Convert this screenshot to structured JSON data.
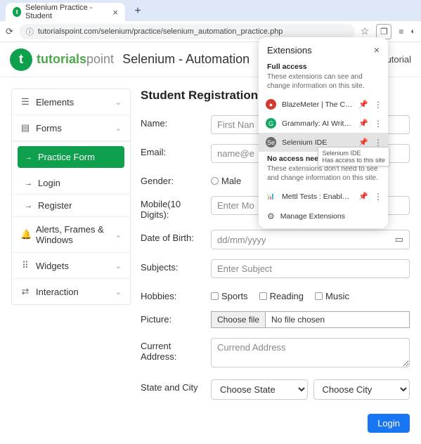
{
  "browser": {
    "tab_title": "Selenium Practice - Student",
    "url": "tutorialspoint.com/selenium/practice/selenium_automation_practice.php",
    "star_icon": "star-icon",
    "ext_icon": "puzzle-icon"
  },
  "header": {
    "logo_green": "tutorials",
    "logo_grey": "point",
    "page_title": "Selenium - Automation",
    "nav_tutorial": "utorial"
  },
  "sidebar": {
    "items": [
      {
        "icon": "☰",
        "label": "Elements",
        "name": "sidebar-item-elements"
      },
      {
        "icon": "▤",
        "label": "Forms",
        "name": "sidebar-item-forms",
        "expanded": true,
        "children": [
          {
            "label": "Practice Form",
            "active": true
          },
          {
            "label": "Login"
          },
          {
            "label": "Register"
          }
        ]
      },
      {
        "icon": "🔔",
        "label": "Alerts, Frames & Windows",
        "name": "sidebar-item-alerts"
      },
      {
        "icon": "⠿",
        "label": "Widgets",
        "name": "sidebar-item-widgets"
      },
      {
        "icon": "⇄",
        "label": "Interaction",
        "name": "sidebar-item-interaction"
      }
    ]
  },
  "form": {
    "heading": "Student Registration Fo",
    "name": {
      "label": "Name:",
      "placeholder": "First Nan"
    },
    "email": {
      "label": "Email:",
      "placeholder": "name@e"
    },
    "gender": {
      "label": "Gender:",
      "options": [
        "Male"
      ]
    },
    "mobile": {
      "label": "Mobile(10 Digits):",
      "placeholder": "Enter Mo"
    },
    "dob": {
      "label": "Date of Birth:",
      "placeholder": "dd/mm/yyyy"
    },
    "subjects": {
      "label": "Subjects:",
      "placeholder": "Enter Subject"
    },
    "hobbies": {
      "label": "Hobbies:",
      "options": [
        "Sports",
        "Reading",
        "Music"
      ]
    },
    "picture": {
      "label": "Picture:",
      "button": "Choose file",
      "status": "No file chosen"
    },
    "address": {
      "label": "Current Address:",
      "placeholder": "Currend Address"
    },
    "state_city": {
      "label": "State and City",
      "state_placeholder": "Choose State",
      "city_placeholder": "Choose City"
    },
    "login_button": "Login"
  },
  "extensions": {
    "title": "Extensions",
    "full_access": {
      "title": "Full access",
      "desc": "These extensions can see and change information on this site."
    },
    "no_access": {
      "title": "No access needed",
      "desc": "These extensions don't need to see and change information on this site."
    },
    "items_full": [
      {
        "name": "BlazeMeter | The Continu...",
        "color": "#d43a2e"
      },
      {
        "name": "Grammarly: AI Writing an...",
        "color": "#16a765"
      },
      {
        "name": "Selenium IDE",
        "color": "#6a6a6a",
        "highlight": true
      }
    ],
    "items_none": [
      {
        "name": "Mettl Tests : Enable Scre...",
        "color": "#5596e6",
        "bar": true
      }
    ],
    "tooltip": {
      "title": "Selenium IDE",
      "desc": "Has access to this site"
    },
    "manage": "Manage Extensions"
  }
}
